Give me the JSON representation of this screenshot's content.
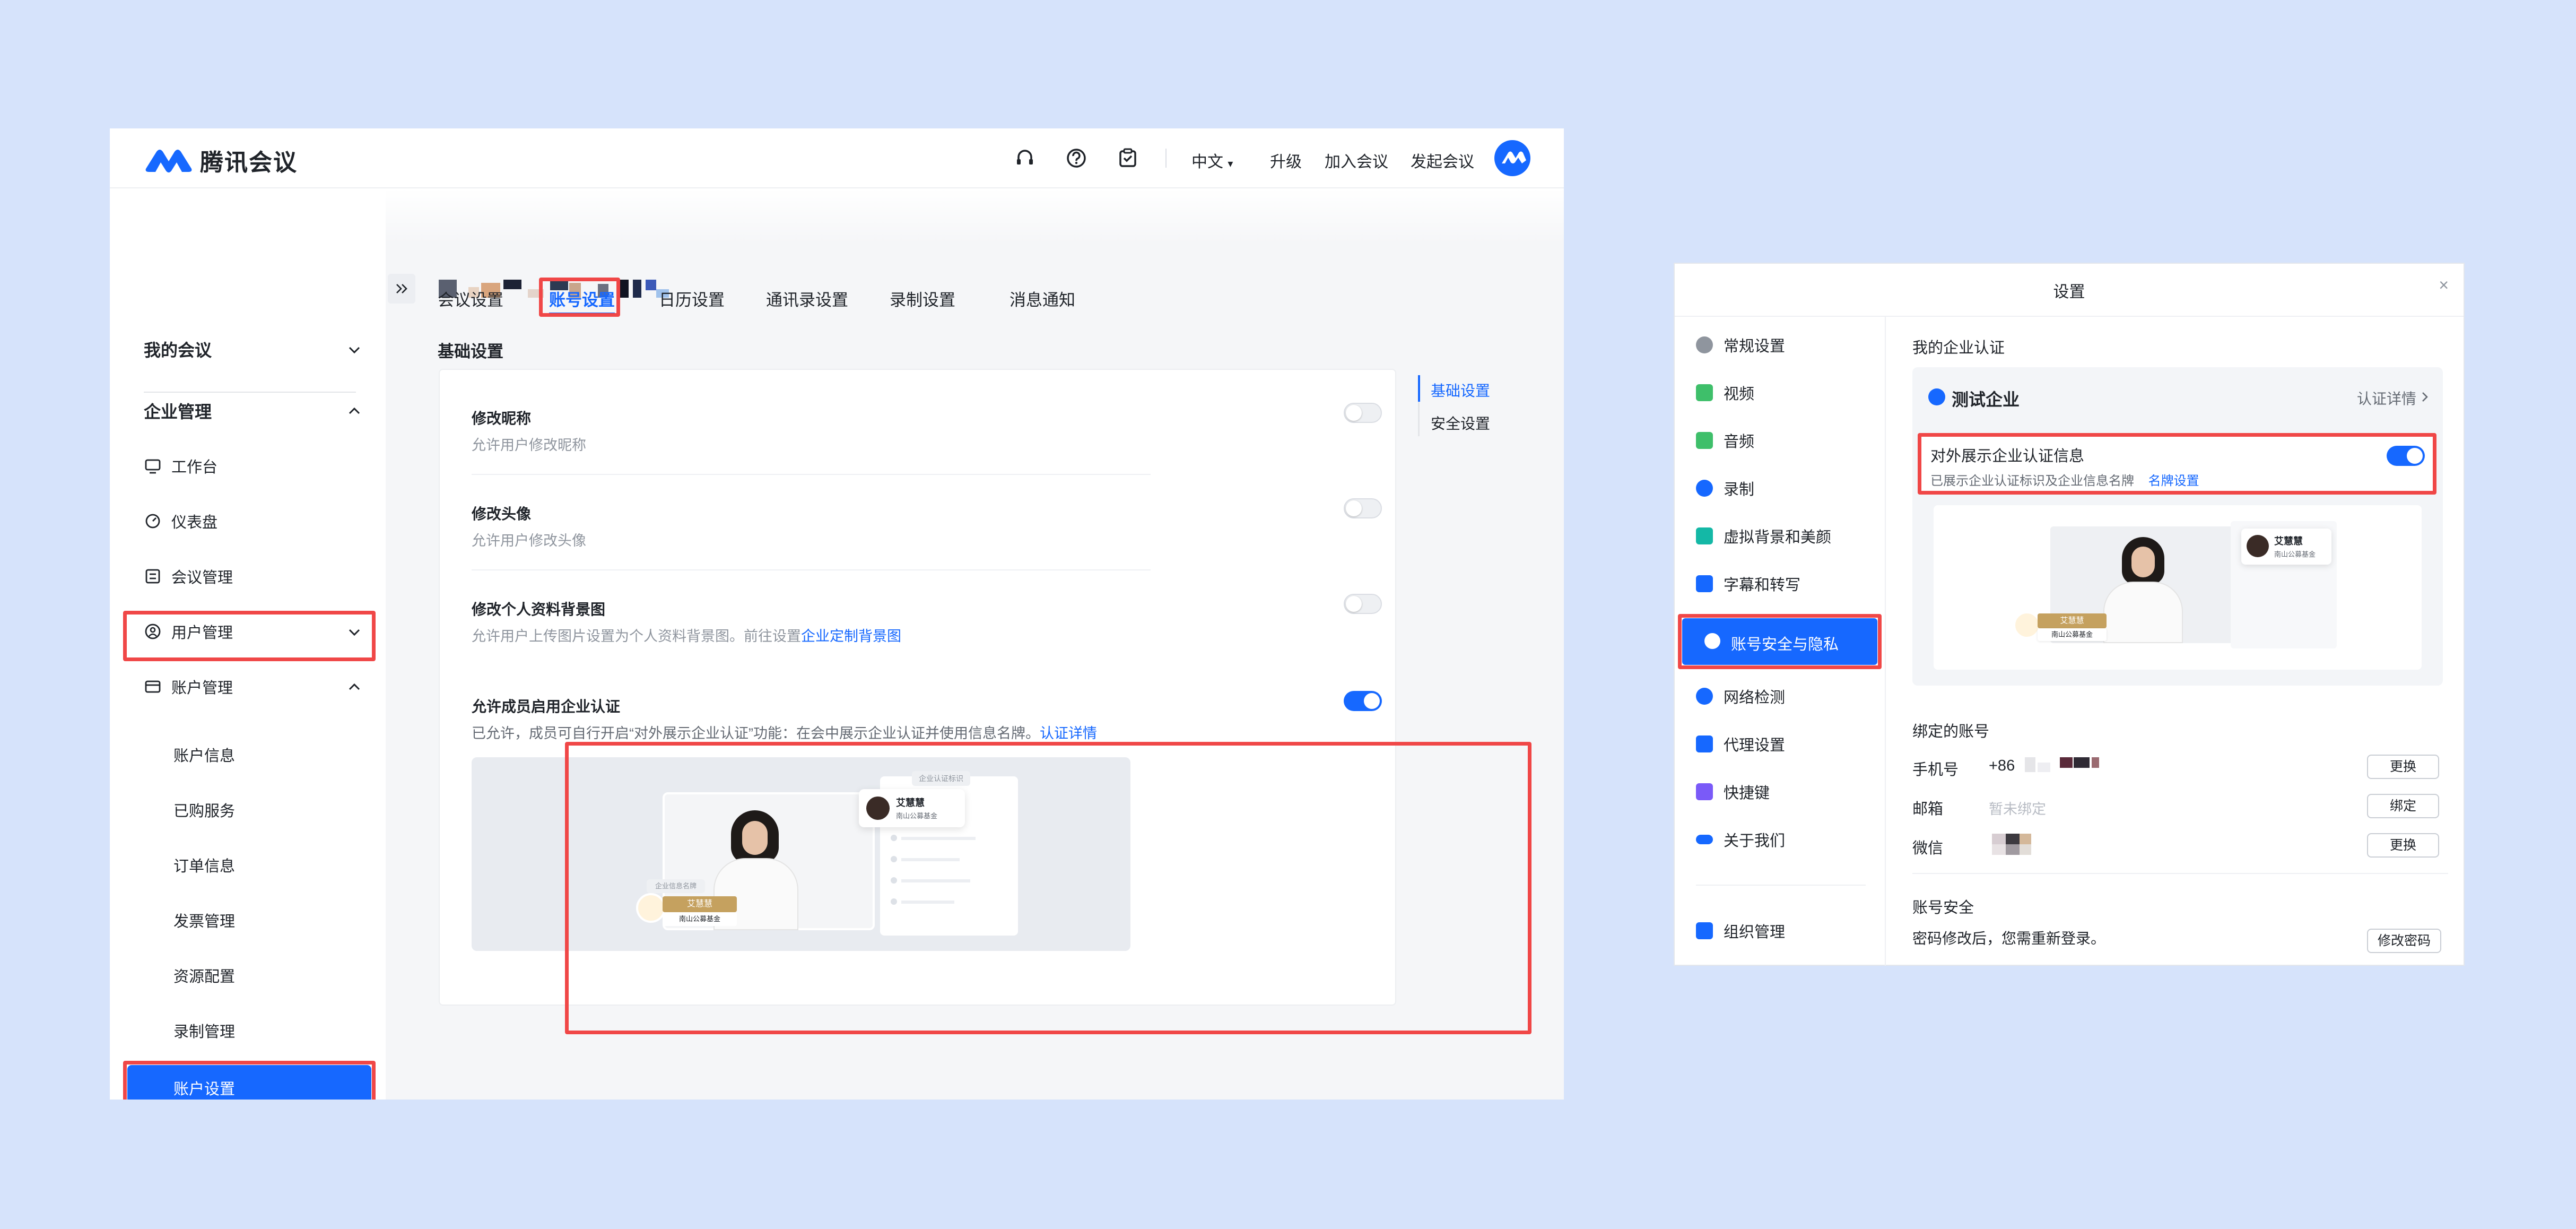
{
  "left_window": {
    "brand": "腾讯会议",
    "header": {
      "language": "中文",
      "upgrade": "升级",
      "join_meeting": "加入会议",
      "start_meeting": "发起会议",
      "icons": [
        "headset-icon",
        "help-icon",
        "clipboard-icon"
      ]
    },
    "sidebar": {
      "my_meetings": "我的会议",
      "enterprise_mgmt": "企业管理",
      "workbench": "工作台",
      "dashboard": "仪表盘",
      "meeting_mgmt": "会议管理",
      "user_mgmt": "用户管理",
      "account_mgmt": "账户管理",
      "sub_items": [
        "账户信息",
        "已购服务",
        "订单信息",
        "发票管理",
        "资源配置",
        "录制管理"
      ],
      "account_settings": "账户设置"
    },
    "tabs": [
      "会议设置",
      "账号设置",
      "日历设置",
      "通讯录设置",
      "录制设置",
      "消息通知"
    ],
    "active_tab": "账号设置",
    "section_title": "基础设置",
    "anchors": [
      "基础设置",
      "安全设置"
    ],
    "settings": [
      {
        "title": "修改昵称",
        "desc": "允许用户修改昵称",
        "enabled": false
      },
      {
        "title": "修改头像",
        "desc": "允许用户修改头像",
        "enabled": false
      },
      {
        "title": "修改个人资料背景图",
        "desc": "允许用户上传图片设置为个人资料背景图。前往设置",
        "link": "企业定制背景图",
        "enabled": false
      },
      {
        "title": "允许成员启用企业认证",
        "desc": "已允许，成员可自行开启“对外展示企业认证”功能：在会中展示企业认证并使用信息名牌。",
        "link": "认证详情",
        "enabled": true
      }
    ],
    "preview": {
      "name": "艾慧慧",
      "org": "南山公募基金",
      "badge_label": "企业信息名牌",
      "card_label": "企业认证标识"
    }
  },
  "right_window": {
    "title": "设置",
    "close": "×",
    "menu": [
      "常规设置",
      "视频",
      "音频",
      "录制",
      "虚拟背景和美颜",
      "字幕和转写",
      "账号安全与隐私",
      "网络检测",
      "代理设置",
      "快捷键",
      "关于我们"
    ],
    "active_menu": "账号安全与隐私",
    "org_mgmt": "组织管理",
    "cert_section": "我的企业认证",
    "company": "测试企业",
    "cert_detail": "认证详情",
    "show_cert_title": "对外展示企业认证信息",
    "show_cert_desc": "已展示企业认证标识及企业信息名牌",
    "show_cert_link": "名牌设置",
    "show_cert_enabled": true,
    "bound_title": "绑定的账号",
    "phone_label": "手机号",
    "phone_prefix": "+86",
    "email_label": "邮箱",
    "email_value": "暂未绑定",
    "wechat_label": "微信",
    "btn_change": "更换",
    "btn_bind": "绑定",
    "security_title": "账号安全",
    "security_desc": "密码修改后，您需重新登录。",
    "btn_change_pwd": "修改密码",
    "preview": {
      "name": "艾慧慧",
      "org": "南山公募基金"
    }
  },
  "colors": {
    "accent": "#1668ff",
    "highlight": "#f04747",
    "background": "#d6e3fb"
  }
}
